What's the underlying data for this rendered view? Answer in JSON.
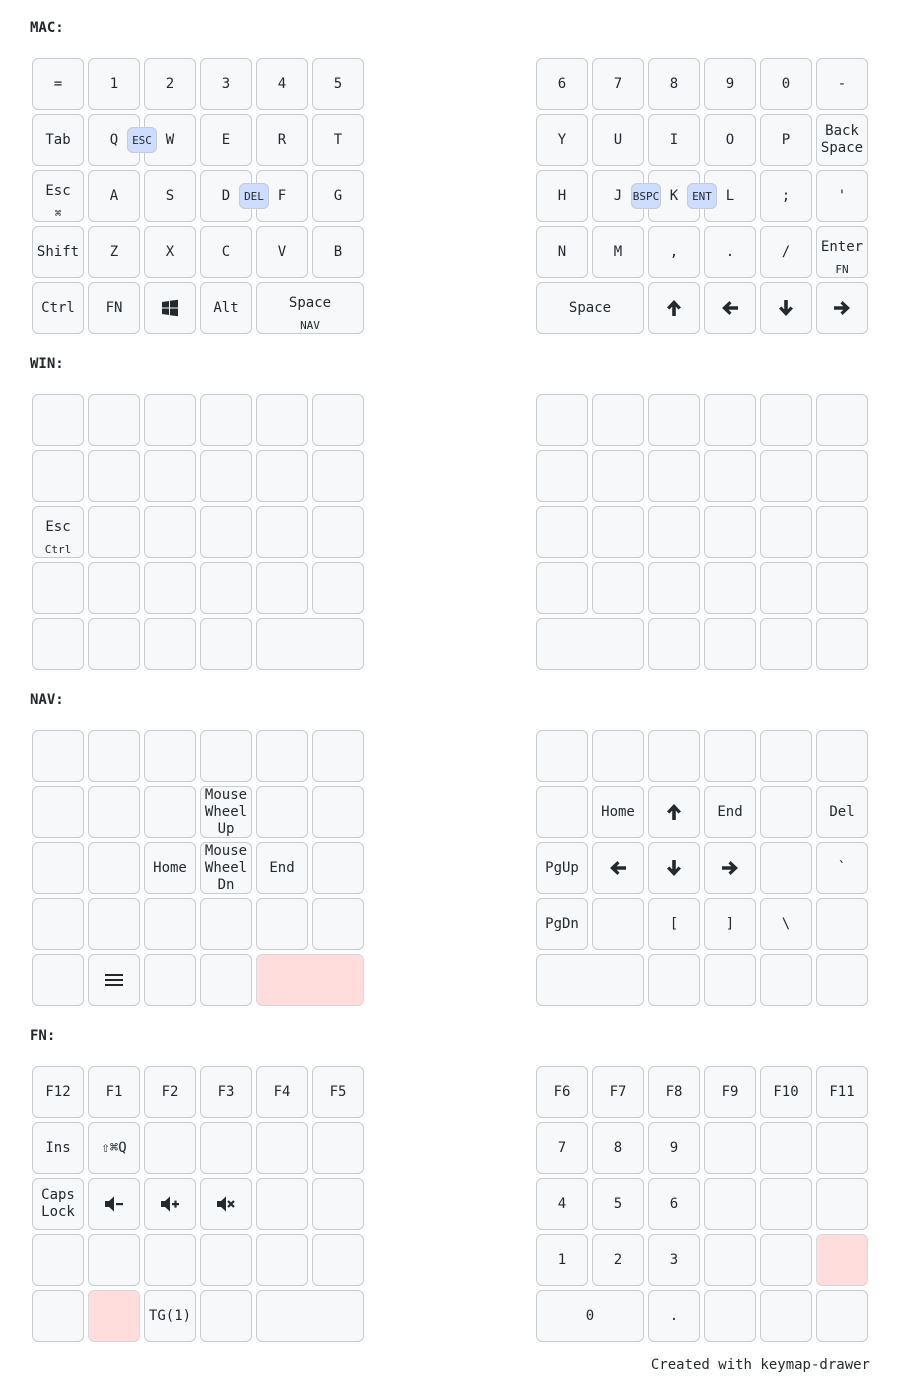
{
  "footer": "Created with keymap-drawer",
  "layers": [
    {
      "name": "MAC:",
      "keys": [
        [
          "=",
          "1",
          "2",
          "3",
          "4",
          "5",
          "6",
          "7",
          "8",
          "9",
          "0",
          "-"
        ],
        [
          "Tab",
          "Q",
          "W",
          "E",
          "R",
          "T",
          "Y",
          "U",
          "I",
          "O",
          "P",
          "Back\nSpace"
        ],
        [
          "Esc",
          "A",
          "S",
          "D",
          "F",
          "G",
          "H",
          "J",
          "K",
          "L",
          ";",
          "'"
        ],
        [
          "Shift",
          "Z",
          "X",
          "C",
          "V",
          "B",
          "N",
          "M",
          ",",
          ".",
          "/",
          "Enter"
        ],
        [
          "Ctrl",
          "FN",
          "",
          "Alt",
          "Space",
          "Space",
          "",
          "",
          "",
          ""
        ]
      ],
      "holds": {
        "2.0": "⌘",
        "3.11": "FN",
        "4.4": "NAV"
      },
      "icons": {
        "4.2": "windows-icon",
        "4.6": "arrow-up-icon",
        "4.7": "arrow-left-icon",
        "4.8": "arrow-down-icon",
        "4.9": "arrow-right-icon"
      },
      "combos": [
        {
          "label": "ESC",
          "anchor": "1.1"
        },
        {
          "label": "DEL",
          "anchor": "2.3"
        },
        {
          "label": "BSPC",
          "anchor": "2.7"
        },
        {
          "label": "ENT",
          "anchor": "2.8"
        }
      ]
    },
    {
      "name": "WIN:",
      "keys": [
        [
          "",
          "",
          "",
          "",
          "",
          "",
          "",
          "",
          "",
          "",
          "",
          ""
        ],
        [
          "",
          "",
          "",
          "",
          "",
          "",
          "",
          "",
          "",
          "",
          "",
          ""
        ],
        [
          "Esc",
          "",
          "",
          "",
          "",
          "",
          "",
          "",
          "",
          "",
          "",
          ""
        ],
        [
          "",
          "",
          "",
          "",
          "",
          "",
          "",
          "",
          "",
          "",
          "",
          ""
        ],
        [
          "",
          "",
          "",
          "",
          "",
          "",
          "",
          "",
          "",
          ""
        ]
      ],
      "holds": {
        "2.0": "Ctrl"
      },
      "icons": {},
      "combos": []
    },
    {
      "name": "NAV:",
      "keys": [
        [
          "",
          "",
          "",
          "",
          "",
          "",
          "",
          "",
          "",
          "",
          "",
          ""
        ],
        [
          "",
          "",
          "",
          "Mouse\nWheel\nUp",
          "",
          "",
          "",
          "Home",
          "",
          "End",
          "",
          "Del"
        ],
        [
          "",
          "",
          "Home",
          "Mouse\nWheel\nDn",
          "End",
          "",
          "PgUp",
          "",
          "",
          "",
          "",
          "`"
        ],
        [
          "",
          "",
          "",
          "",
          "",
          "",
          "PgDn",
          "",
          "[",
          "]",
          "\\",
          ""
        ],
        [
          "",
          "",
          "",
          "",
          "",
          "",
          "",
          "",
          "",
          ""
        ]
      ],
      "holds": {},
      "icons": {
        "4.1": "menu-icon",
        "1.8": "arrow-up-icon",
        "2.7": "arrow-left-icon",
        "2.8": "arrow-down-icon",
        "2.9": "arrow-right-icon"
      },
      "held": [
        "4.4"
      ],
      "combos": []
    },
    {
      "name": "FN:",
      "keys": [
        [
          "F12",
          "F1",
          "F2",
          "F3",
          "F4",
          "F5",
          "F6",
          "F7",
          "F8",
          "F9",
          "F10",
          "F11"
        ],
        [
          "Ins",
          "⇧⌘Q",
          "",
          "",
          "",
          "",
          "7",
          "8",
          "9",
          "",
          "",
          ""
        ],
        [
          "Caps\nLock",
          "",
          "",
          "",
          "",
          "",
          "4",
          "5",
          "6",
          "",
          "",
          ""
        ],
        [
          "",
          "",
          "",
          "",
          "",
          "",
          "1",
          "2",
          "3",
          "",
          "",
          ""
        ],
        [
          "",
          "",
          "TG(1)",
          "",
          "",
          "0",
          ".",
          "",
          "",
          ""
        ]
      ],
      "holds": {},
      "icons": {
        "2.1": "volume-down-icon",
        "2.2": "volume-up-icon",
        "2.3": "volume-mute-icon"
      },
      "held": [
        "4.1",
        "3.11"
      ],
      "combos": []
    }
  ]
}
